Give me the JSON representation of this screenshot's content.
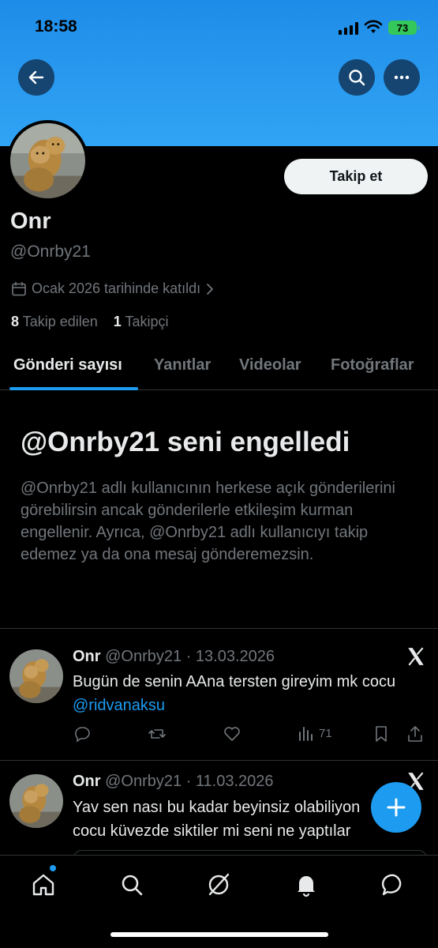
{
  "status_bar": {
    "time": "18:58",
    "battery": "73",
    "icons": [
      "signal-icon",
      "wifi-icon",
      "battery-icon"
    ]
  },
  "header": {
    "icons": [
      "back-arrow-icon",
      "search-icon",
      "more-icon"
    ]
  },
  "profile": {
    "follow_label": "Takip et",
    "name": "Onr",
    "handle": "@Onrby21",
    "joined": "Ocak 2026 tarihinde katıldı",
    "following_count": "8",
    "following_label": "Takip edilen",
    "followers_count": "1",
    "followers_label": "Takipçi"
  },
  "tabs": [
    "Gönderi sayısı",
    "Yanıtlar",
    "Videolar",
    "Fotoğraflar"
  ],
  "blocked": {
    "title": "@Onrby21 seni engelledi",
    "text": "@Onrby21 adlı kullanıcının herkese açık gönderilerini görebilirsin ancak gönderilerle etkileşim kurman engellenir. Ayrıca, @Onrby21 adlı kullanıcıyı takip edemez ya da ona mesaj gönderemezsin."
  },
  "tweets": [
    {
      "name": "Onr",
      "handle_date": "@Onrby21 · 13.03.2026",
      "text": "Bugün de senin AAna tersten gireyim mk cocu ",
      "mention": "@ridvanaksu",
      "views": "71"
    },
    {
      "name": "Onr",
      "handle_date": "@Onrby21 · 11.03.2026",
      "text": "Yav sen nası bu kadar beyinsiz olabiliyon cocu küvezde siktiler mi seni ne yaptılar"
    }
  ],
  "colors": {
    "accent": "#1d9bf0",
    "background": "#000000",
    "banner": "#2a9bf0",
    "muted_text": "#71767b"
  },
  "bottom_nav": [
    "home-icon",
    "search-icon",
    "grok-icon",
    "notifications-icon",
    "messages-icon"
  ]
}
